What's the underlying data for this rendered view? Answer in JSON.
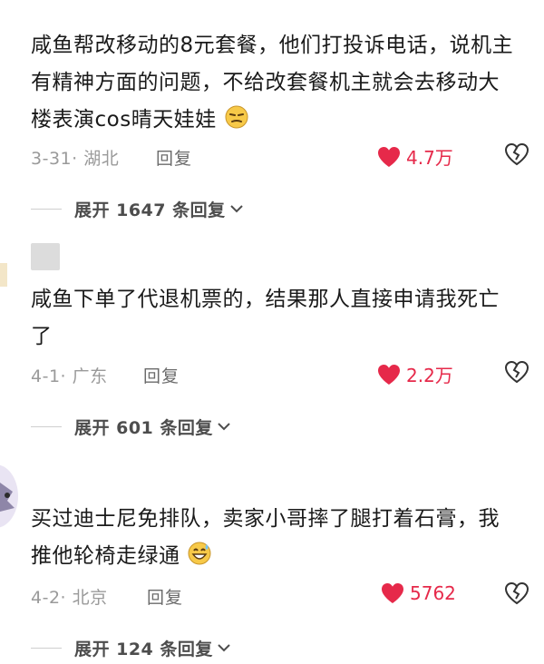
{
  "comments": [
    {
      "text": "咸鱼帮改移动的8元套餐，他们打投诉电话，说机主有精神方面的问题，不给改套餐机主就会去移动大楼表演cos晴天娃娃",
      "emoji": "smirk-face-emoji",
      "date": "3-31· 湖北",
      "reply_label": "回复",
      "likes": "4.7万",
      "expand_label": "展开 1647 条回复"
    },
    {
      "text": "咸鱼下单了代退机票的，结果那人直接申请我死亡了",
      "date": "4-1· 广东",
      "reply_label": "回复",
      "likes": "2.2万",
      "expand_label": "展开 601 条回复"
    },
    {
      "text": "买过迪士尼免排队，卖家小哥摔了腿打着石膏，我推他轮椅走绿通",
      "emoji": "grin-sweat-emoji",
      "date": "4-2· 北京",
      "reply_label": "回复",
      "likes": "5762",
      "expand_label": "展开 124 条回复"
    }
  ],
  "colors": {
    "like": "#e6294a",
    "meta": "#9a9a9a",
    "text": "#1a1a1a"
  },
  "icons": [
    "heart-icon",
    "broken-heart-icon",
    "chevron-down-icon"
  ]
}
